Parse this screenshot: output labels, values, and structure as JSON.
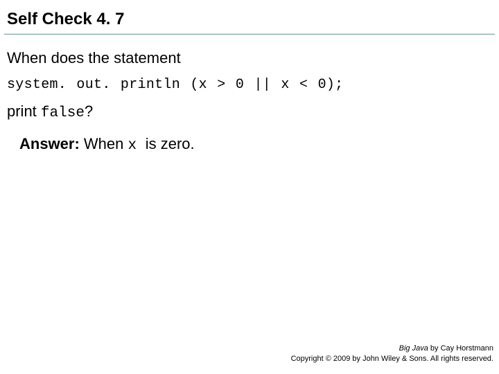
{
  "title": "Self Check 4. 7",
  "body": {
    "q_prefix": "When does the statement",
    "code_line": "system. out. println (x > 0 || x < 0);",
    "q_suffix_pre": "print ",
    "q_suffix_mono": "false",
    "q_suffix_post": "?",
    "answer_label": "Answer:",
    "answer_pre": " When ",
    "answer_mono": "x ",
    "answer_post": " is zero."
  },
  "footer": {
    "book": "Big Java",
    "byline": " by Cay Horstmann",
    "copyright": "Copyright © 2009 by John Wiley & Sons.  All rights reserved."
  }
}
